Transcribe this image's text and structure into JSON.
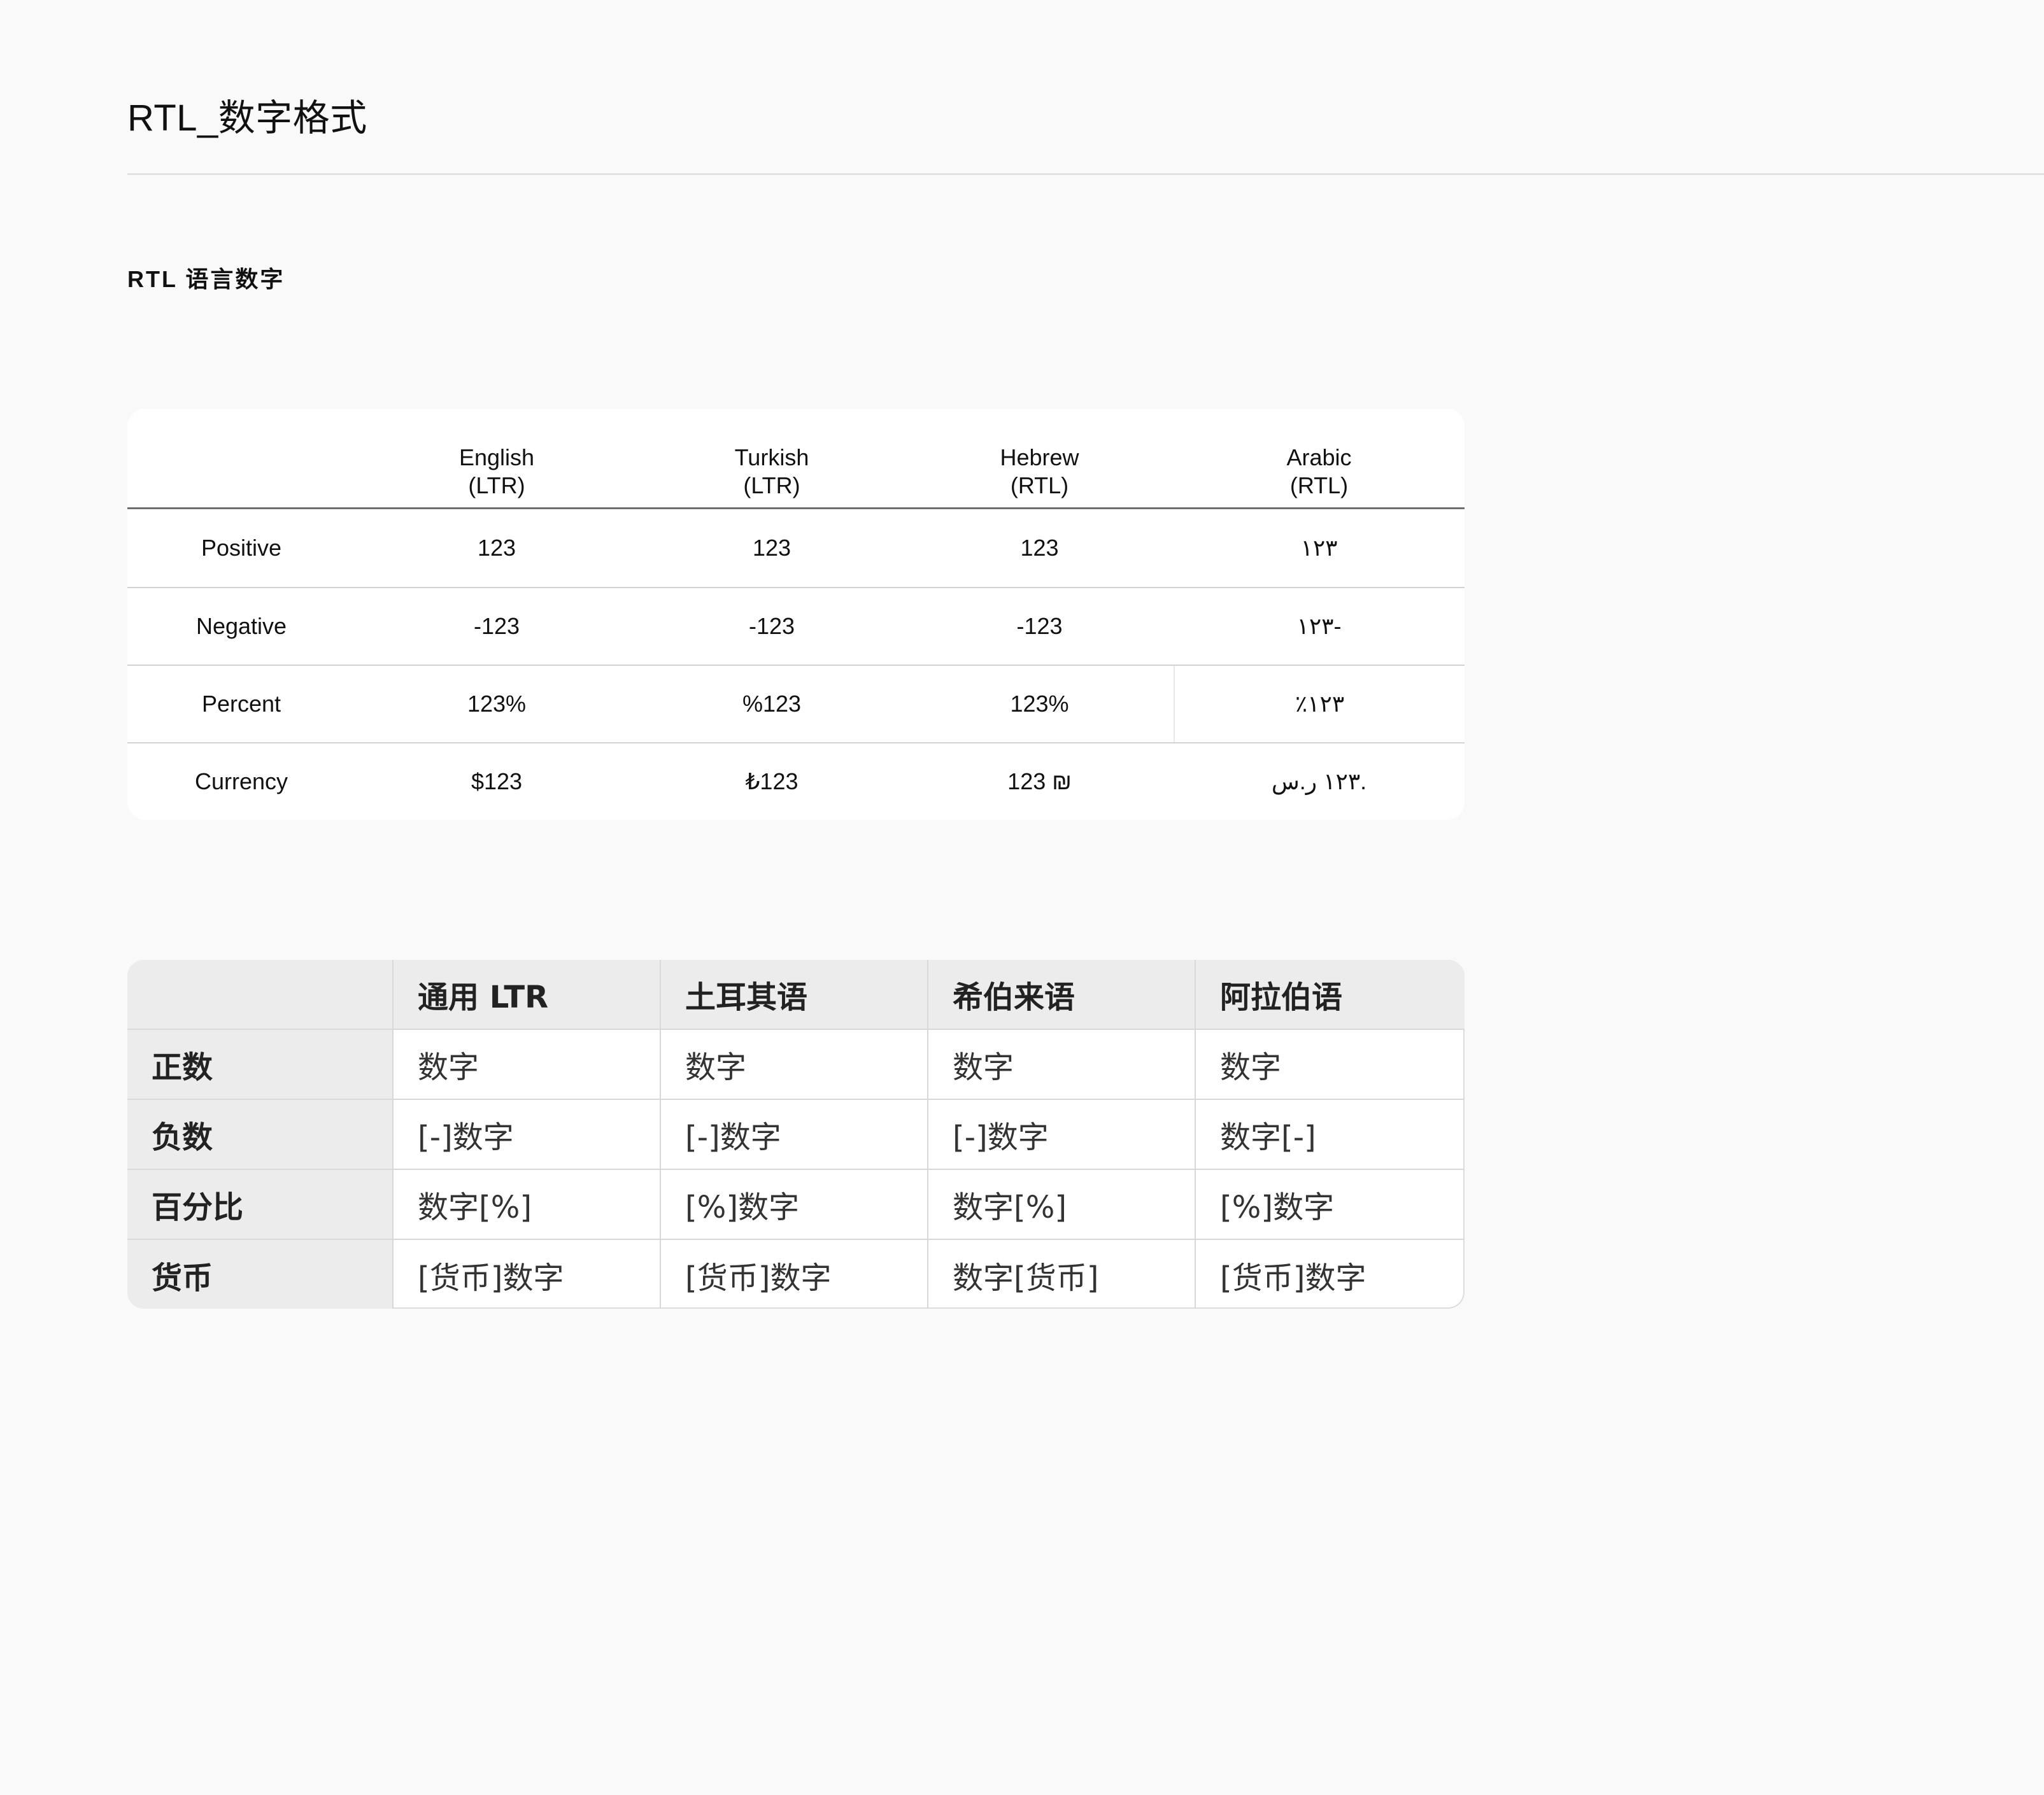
{
  "page": {
    "title": "RTL_数字格式",
    "section_heading": "RTL 语言数字"
  },
  "table1": {
    "headers": [
      {
        "line1": "",
        "line2": ""
      },
      {
        "line1": "English",
        "line2": "(LTR)"
      },
      {
        "line1": "Turkish",
        "line2": "(LTR)"
      },
      {
        "line1": "Hebrew",
        "line2": "(RTL)"
      },
      {
        "line1": "Arabic",
        "line2": "(RTL)"
      }
    ],
    "rows": [
      {
        "label": "Positive",
        "en": "123",
        "tr": "123",
        "he": "123",
        "ar": "١٢٣"
      },
      {
        "label": "Negative",
        "en": "-123",
        "tr": "-123",
        "he": "-123",
        "ar": "١٢٣-"
      },
      {
        "label": "Percent",
        "en": "123%",
        "tr": "%123",
        "he": "123%",
        "ar": "٪١٢٣"
      },
      {
        "label": "Currency",
        "en": "$123",
        "tr": "₺123",
        "he": "123 ₪",
        "ar": "١٢٣ ر.س."
      }
    ]
  },
  "table2": {
    "headers": [
      "",
      "通用 LTR",
      "土耳其语",
      "希伯来语",
      "阿拉伯语"
    ],
    "rows": [
      {
        "label": "正数",
        "ltr": "数字",
        "tr": "数字",
        "he": "数字",
        "ar": "数字"
      },
      {
        "label": "负数",
        "ltr": "[-]数字",
        "tr": "[-]数字",
        "he": "[-]数字",
        "ar": "数字[-]"
      },
      {
        "label": "百分比",
        "ltr": "数字[%]",
        "tr": "[%]数字",
        "he": "数字[%]",
        "ar": "[%]数字"
      },
      {
        "label": "货币",
        "ltr": "[货币]数字",
        "tr": "[货币]数字",
        "he": "数字[货币]",
        "ar": "[货币]数字"
      }
    ]
  }
}
